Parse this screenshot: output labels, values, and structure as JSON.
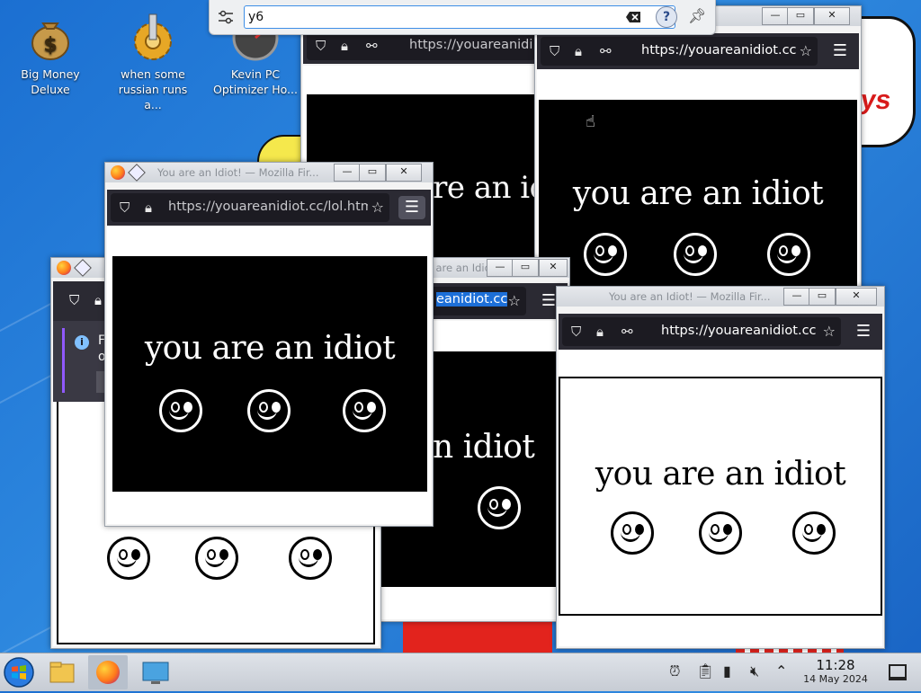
{
  "desktop": {
    "icons": [
      {
        "label": "Big Money Deluxe",
        "icon": "money-bag-icon"
      },
      {
        "label": "when some russian runs a...",
        "icon": "gear-icon"
      },
      {
        "label": "Kevin PC Optimizer Ho...",
        "icon": "speedometer-icon"
      }
    ],
    "popup_text": "ys"
  },
  "search": {
    "value": "y6",
    "icons": [
      "settings-sliders-icon",
      "clear-icon",
      "help-icon",
      "pin-icon"
    ]
  },
  "windows": {
    "title": "You are an Idiot! — Mozilla Fir...",
    "title_short": "You are an Idiot! — Mo",
    "url_full": "https://youareanidiot.cc",
    "url_lol": "https://youareanidiot.cc/lol.htm",
    "url_back": "https://youareanidi",
    "url_highlight": "eanidiot.cc",
    "url_faint": "https://you",
    "message": "you are an idiot",
    "message_partial": "n idiot",
    "message_back": "you are an id",
    "notification_text_1": "Fi",
    "notification_text_2": "op"
  },
  "taskbar": {
    "time": "11:28",
    "date": "14 May 2024"
  },
  "colors": {
    "desktop_blue": "#1b6fd1",
    "firefox_navbar": "#2b2a33",
    "accent_red": "#e2231d"
  }
}
